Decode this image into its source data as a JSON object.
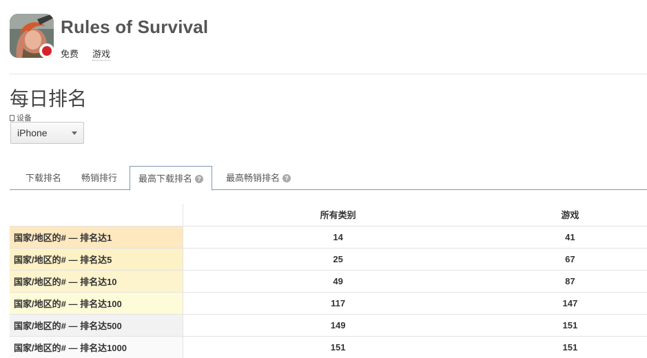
{
  "app": {
    "title": "Rules of Survival",
    "price": "免费",
    "genre": "游戏",
    "icon": "game-app-icon",
    "publisher_badge": "netease-badge"
  },
  "section": {
    "title": "每日排名",
    "device_label": "设备",
    "device_value": "iPhone"
  },
  "tabs": [
    {
      "label": "下载排名",
      "active": false
    },
    {
      "label": "畅销排行",
      "active": false
    },
    {
      "label": "最高下载排名",
      "active": true,
      "help": "?"
    },
    {
      "label": "最高畅销排名",
      "active": false,
      "help": "?"
    }
  ],
  "table": {
    "headers": [
      "所有类别",
      "游戏"
    ],
    "rows": [
      {
        "label": "国家/地区的# — 排名达1",
        "values": [
          "14",
          "41"
        ],
        "color": "#fde8c0"
      },
      {
        "label": "国家/地区的# — 排名达5",
        "values": [
          "25",
          "67"
        ],
        "color": "#fdf1c6"
      },
      {
        "label": "国家/地区的# — 排名达10",
        "values": [
          "49",
          "87"
        ],
        "color": "#fdf4cd"
      },
      {
        "label": "国家/地区的# — 排名达100",
        "values": [
          "117",
          "147"
        ],
        "color": "#fefbd8"
      },
      {
        "label": "国家/地区的# — 排名达500",
        "values": [
          "149",
          "151"
        ],
        "color": "#f2f2f2"
      },
      {
        "label": "国家/地区的# — 排名达1000",
        "values": [
          "151",
          "151"
        ],
        "color": "#fafafa"
      }
    ]
  }
}
